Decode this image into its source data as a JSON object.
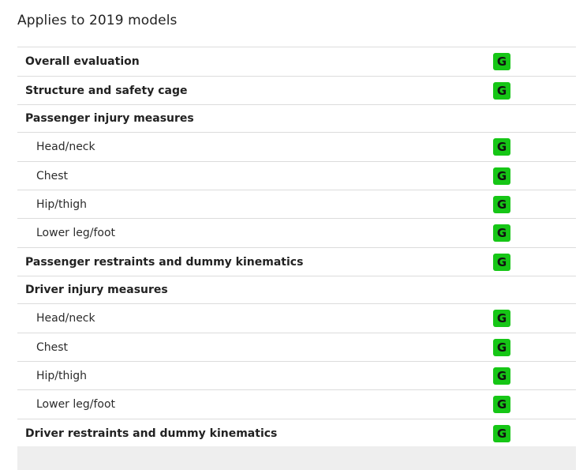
{
  "header": {
    "title": "Applies to 2019 models"
  },
  "rows": [
    {
      "label": "Overall evaluation",
      "rating": "G"
    },
    {
      "label": "Structure and safety cage",
      "rating": "G"
    },
    {
      "label": "Passenger injury measures",
      "rating": ""
    },
    {
      "label": "Head/neck",
      "rating": "G"
    },
    {
      "label": "Chest",
      "rating": "G"
    },
    {
      "label": "Hip/thigh",
      "rating": "G"
    },
    {
      "label": "Lower leg/foot",
      "rating": "G"
    },
    {
      "label": "Passenger restraints and dummy kinematics",
      "rating": "G"
    },
    {
      "label": "Driver injury measures",
      "rating": ""
    },
    {
      "label": "Head/neck",
      "rating": "G"
    },
    {
      "label": "Chest",
      "rating": "G"
    },
    {
      "label": "Hip/thigh",
      "rating": "G"
    },
    {
      "label": "Lower leg/foot",
      "rating": "G"
    },
    {
      "label": "Driver restraints and dummy kinematics",
      "rating": "G"
    }
  ],
  "colors": {
    "good_badge": "#16c616",
    "divider": "#dcdcdc"
  }
}
